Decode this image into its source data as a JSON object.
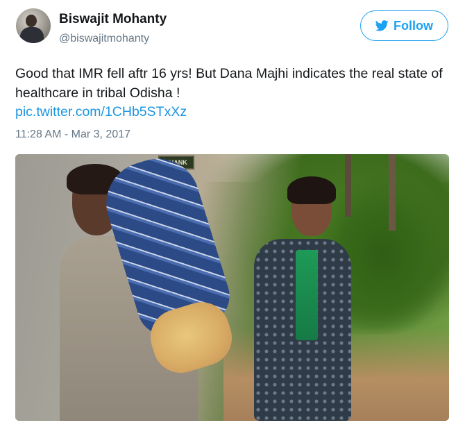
{
  "author": {
    "name": "Biswajit Mohanty",
    "handle": "@biswajitmohanty"
  },
  "follow_button": {
    "label": "Follow",
    "icon": "twitter-bird-icon"
  },
  "tweet": {
    "text": "Good that IMR fell aftr 16 yrs! But Dana Majhi indicates the real state of healthcare in tribal Odisha !",
    "link": "pic.twitter.com/1CHb5STxXz",
    "timestamp": "11:28 AM - Mar 3, 2017"
  },
  "photo": {
    "sign_text": "THANK YOU"
  },
  "colors": {
    "accent": "#1da1f2",
    "link": "#1b95e0",
    "muted": "#657786",
    "text": "#14171a"
  }
}
